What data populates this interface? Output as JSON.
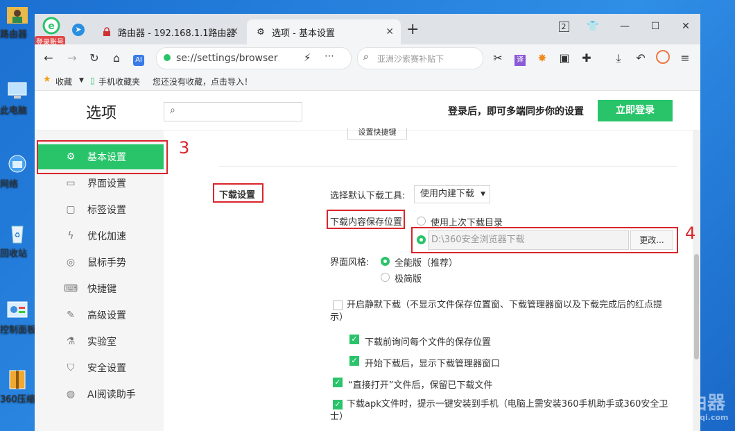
{
  "desktop": {
    "icons": [
      {
        "label": "路由器",
        "icon": "folder-person-icon"
      },
      {
        "label": "此电脑",
        "icon": "computer-icon"
      },
      {
        "label": "网络",
        "icon": "network-icon"
      },
      {
        "label": "回收站",
        "icon": "recycle-bin-icon"
      },
      {
        "label": "控制面板",
        "icon": "control-panel-icon"
      },
      {
        "label": "360压缩",
        "icon": "archive-icon"
      }
    ],
    "watermark": "路由器",
    "watermark_url": "luyouqi.com"
  },
  "browser": {
    "account_badge": "登录账号",
    "tabs": [
      {
        "title": "路由器 - 192.168.1.1路由器设",
        "icon": "router-lock-icon",
        "active": false
      },
      {
        "title": "选项 - 基本设置",
        "icon": "gear-icon",
        "active": true
      }
    ],
    "window_counter": "2",
    "address": "se://settings/browser",
    "search_placeholder": "亚洲沙索赛补贴下",
    "bookmarks": {
      "favorites_label": "收藏",
      "mobile_label": "手机收藏夹",
      "import_hint": "您还没有收藏，点击导入！"
    }
  },
  "settings": {
    "title": "选项",
    "login_hint": "登录后，即可多端同步你的设置",
    "login_button": "立即登录",
    "sidebar": [
      {
        "label": "基本设置",
        "icon": "gear-icon",
        "active": true
      },
      {
        "label": "界面设置",
        "icon": "window-icon",
        "active": false
      },
      {
        "label": "标签设置",
        "icon": "tab-icon",
        "active": false
      },
      {
        "label": "优化加速",
        "icon": "lightning-icon",
        "active": false
      },
      {
        "label": "鼠标手势",
        "icon": "mouse-icon",
        "active": false
      },
      {
        "label": "快捷键",
        "icon": "keyboard-icon",
        "active": false
      },
      {
        "label": "高级设置",
        "icon": "wrench-icon",
        "active": false
      },
      {
        "label": "实验室",
        "icon": "flask-icon",
        "active": false
      },
      {
        "label": "安全设置",
        "icon": "shield-icon",
        "active": false
      },
      {
        "label": "AI阅读助手",
        "icon": "ai-icon",
        "active": false
      }
    ],
    "shortcut_button": "设置快捷键",
    "download": {
      "section_title": "下载设置",
      "default_tool_label": "选择默认下载工具:",
      "default_tool_value": "使用内建下载",
      "save_location_label": "下载内容保存位置",
      "use_last_dir": "使用上次下载目录",
      "path_value": "D:\\360安全浏览器下载",
      "change_button": "更改...",
      "ui_style_label": "界面风格:",
      "style_full": "全能版（推荐）",
      "style_simple": "极简版",
      "silent_download": "开启静默下载（不显示文件保存位置窗、下载管理器窗以及下载完成后的红点提示）",
      "ask_location": "下载前询问每个文件的保存位置",
      "show_manager": "开始下载后，显示下载管理器窗口",
      "keep_file": "“直接打开”文件后，保留已下载文件",
      "apk_prompt": "下载apk文件时，提示一键安装到手机（电脑上需安装360手机助手或360安全卫士）"
    }
  },
  "annotations": {
    "step3": "3",
    "step4": "4"
  },
  "colors": {
    "accent": "#29c46a",
    "annotation": "#d9252b"
  }
}
